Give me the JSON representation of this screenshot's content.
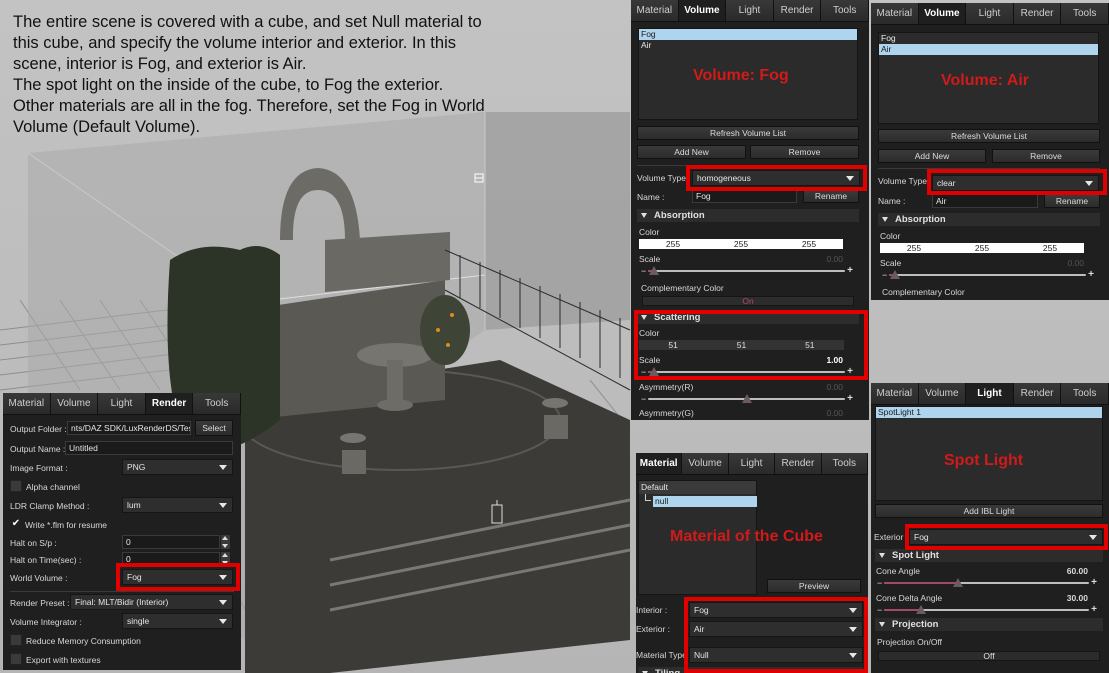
{
  "caption": {
    "lines": [
      "The entire scene is covered with a cube, and set Null material to",
      "this cube, and specify the volume interior and exterior. In this",
      "scene, interior is Fog, and exterior is Air.",
      "The spot light on the inside of the cube, to Fog the exterior.",
      "Other materials are all in the fog. Therefore, set the Fog in World",
      "Volume (Default Volume)."
    ]
  },
  "tabs": [
    "Material",
    "Volume",
    "Light",
    "Render",
    "Tools"
  ],
  "volume_fog_panel": {
    "active_tab": "Volume",
    "list": [
      {
        "label": "Fog",
        "selected": true
      },
      {
        "label": "Air",
        "selected": false
      }
    ],
    "overlay": "Volume: Fog",
    "refresh_label": "Refresh Volume List",
    "add_new_label": "Add New",
    "remove_label": "Remove",
    "volume_type_label": "Volume Type",
    "volume_type_value": "homogeneous",
    "name_label": "Name :",
    "name_value": "Fog",
    "rename_label": "Rename",
    "absorption": {
      "title": "Absorption",
      "color_label": "Color",
      "color": [
        "255",
        "255",
        "255"
      ],
      "scale_label": "Scale",
      "scale_value": "0.00",
      "scale_fraction": 0.03,
      "complementary_label": "Complementary Color",
      "complementary_value": "On"
    },
    "scattering": {
      "title": "Scattering",
      "color_label": "Color",
      "color": [
        "51",
        "51",
        "51"
      ],
      "scale_label": "Scale",
      "scale_value": "1.00",
      "scale_fraction": 0.03
    },
    "asymmetry_r_label": "Asymmetry(R)",
    "asymmetry_r_value": "0.00",
    "asymmetry_r_fraction": 0.5,
    "asymmetry_g_label": "Asymmetry(G)",
    "asymmetry_g_value": "0.00"
  },
  "volume_air_panel": {
    "active_tab": "Volume",
    "list": [
      {
        "label": "Fog",
        "selected": false
      },
      {
        "label": "Air",
        "selected": true
      }
    ],
    "overlay": "Volume: Air",
    "refresh_label": "Refresh Volume List",
    "add_new_label": "Add New",
    "remove_label": "Remove",
    "volume_type_label": "Volume Type :",
    "volume_type_value": "clear",
    "name_label": "Name :",
    "name_value": "Air",
    "rename_label": "Rename",
    "absorption": {
      "title": "Absorption",
      "color_label": "Color",
      "color": [
        "255",
        "255",
        "255"
      ],
      "scale_label": "Scale",
      "scale_value": "0.00",
      "scale_fraction": 0.03,
      "complementary_label": "Complementary Color"
    }
  },
  "light_panel": {
    "active_tab": "Light",
    "list": [
      {
        "label": "SpotLight 1",
        "selected": true
      }
    ],
    "overlay": "Spot Light",
    "add_ibl_label": "Add IBL Light",
    "exterior_label": "Exterior",
    "exterior_value": "Fog",
    "spot_section": "Spot Light",
    "cone_angle_label": "Cone Angle",
    "cone_angle_value": "60.00",
    "cone_angle_fraction": 0.36,
    "cone_delta_label": "Cone Delta Angle",
    "cone_delta_value": "30.00",
    "cone_delta_fraction": 0.18,
    "projection_section": "Projection",
    "projection_label": "Projection On/Off",
    "projection_value": "Off"
  },
  "material_panel": {
    "active_tab": "Material",
    "tree_root": "Default",
    "tree_child": "null",
    "overlay": "Material of the Cube",
    "preview_label": "Preview",
    "interior_label": "Interior :",
    "interior_value": "Fog",
    "exterior_label": "Exterior :",
    "exterior_value": "Air",
    "material_type_label": "Material Type",
    "material_type_value": "Null",
    "tiling_section": "Tiling"
  },
  "render_panel": {
    "active_tab": "Render",
    "output_folder_label": "Output Folder :",
    "output_folder_value": "nts/DAZ SDK/LuxRenderDS/Test",
    "select_label": "Select",
    "output_name_label": "Output Name :",
    "output_name_value": "Untitled",
    "image_format_label": "Image Format :",
    "image_format_value": "PNG",
    "alpha_label": "Alpha channel",
    "alpha_checked": false,
    "ldr_label": "LDR Clamp Method :",
    "ldr_value": "lum",
    "write_flm_label": "Write *.flm for resume",
    "write_flm_checked": true,
    "check_glyph": "✔",
    "halt_sp_label": "Halt on S/p :",
    "halt_sp_value": "0",
    "halt_time_label": "Halt on Time(sec) :",
    "halt_time_value": "0",
    "world_volume_label": "World Volume :",
    "world_volume_value": "Fog",
    "render_preset_label": "Render Preset :",
    "render_preset_value": "Final: MLT/Bidir (Interior)",
    "volume_integrator_label": "Volume Integrator :",
    "volume_integrator_value": "single",
    "reduce_memory_label": "Reduce Memory Consumption",
    "reduce_memory_checked": false,
    "export_textures_label": "Export with textures",
    "export_textures_checked": false
  },
  "colors": {
    "highlight": "#e00000",
    "overlay_text": "#d11a1a",
    "selection": "#aed4ee",
    "panel_bg": "#1f1f1f"
  }
}
